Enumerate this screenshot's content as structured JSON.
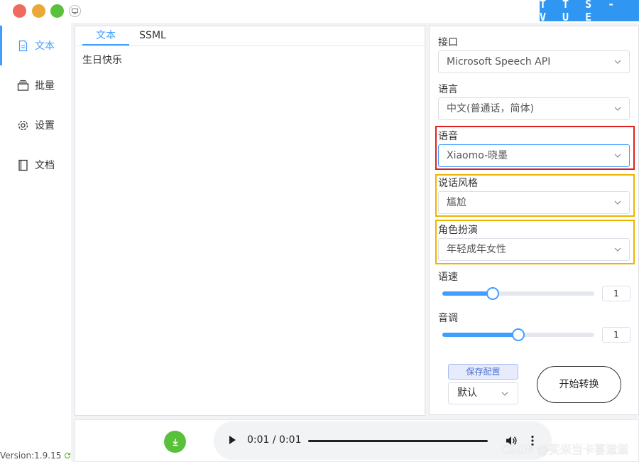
{
  "window": {
    "brand": "T T S - V U E"
  },
  "sidebar": {
    "items": [
      {
        "label": "文本",
        "icon": "document-icon",
        "active": true
      },
      {
        "label": "批量",
        "icon": "layers-icon",
        "active": false
      },
      {
        "label": "设置",
        "icon": "gear-icon",
        "active": false
      },
      {
        "label": "文档",
        "icon": "notebook-icon",
        "active": false
      }
    ],
    "version": "Version:1.9.15"
  },
  "editor": {
    "tabs": [
      {
        "label": "文本",
        "active": true
      },
      {
        "label": "SSML",
        "active": false
      }
    ],
    "text": "生日快乐"
  },
  "settings": {
    "api": {
      "label": "接口",
      "value": "Microsoft Speech API"
    },
    "language": {
      "label": "语言",
      "value": "中文(普通话，简体)"
    },
    "voice": {
      "label": "语音",
      "value": "Xiaomo-晓墨"
    },
    "style": {
      "label": "说话风格",
      "value": "尴尬"
    },
    "role": {
      "label": "角色扮演",
      "value": "年轻成年女性"
    },
    "rate": {
      "label": "语速",
      "value": "1",
      "position": 0.33
    },
    "pitch": {
      "label": "音调",
      "value": "1",
      "position": 0.5
    },
    "save_config": "保存配置",
    "preset": "默认",
    "start": "开始转换"
  },
  "player": {
    "time": "0:01 / 0:01",
    "progress": 1.0
  },
  "watermark": "CSDN @买米当卡喜滋滋",
  "colors": {
    "accent": "#409eff",
    "brand": "#2f96f2",
    "download": "#59c03b",
    "highlight_red": "#e02020",
    "highlight_orange": "#f0b400"
  }
}
